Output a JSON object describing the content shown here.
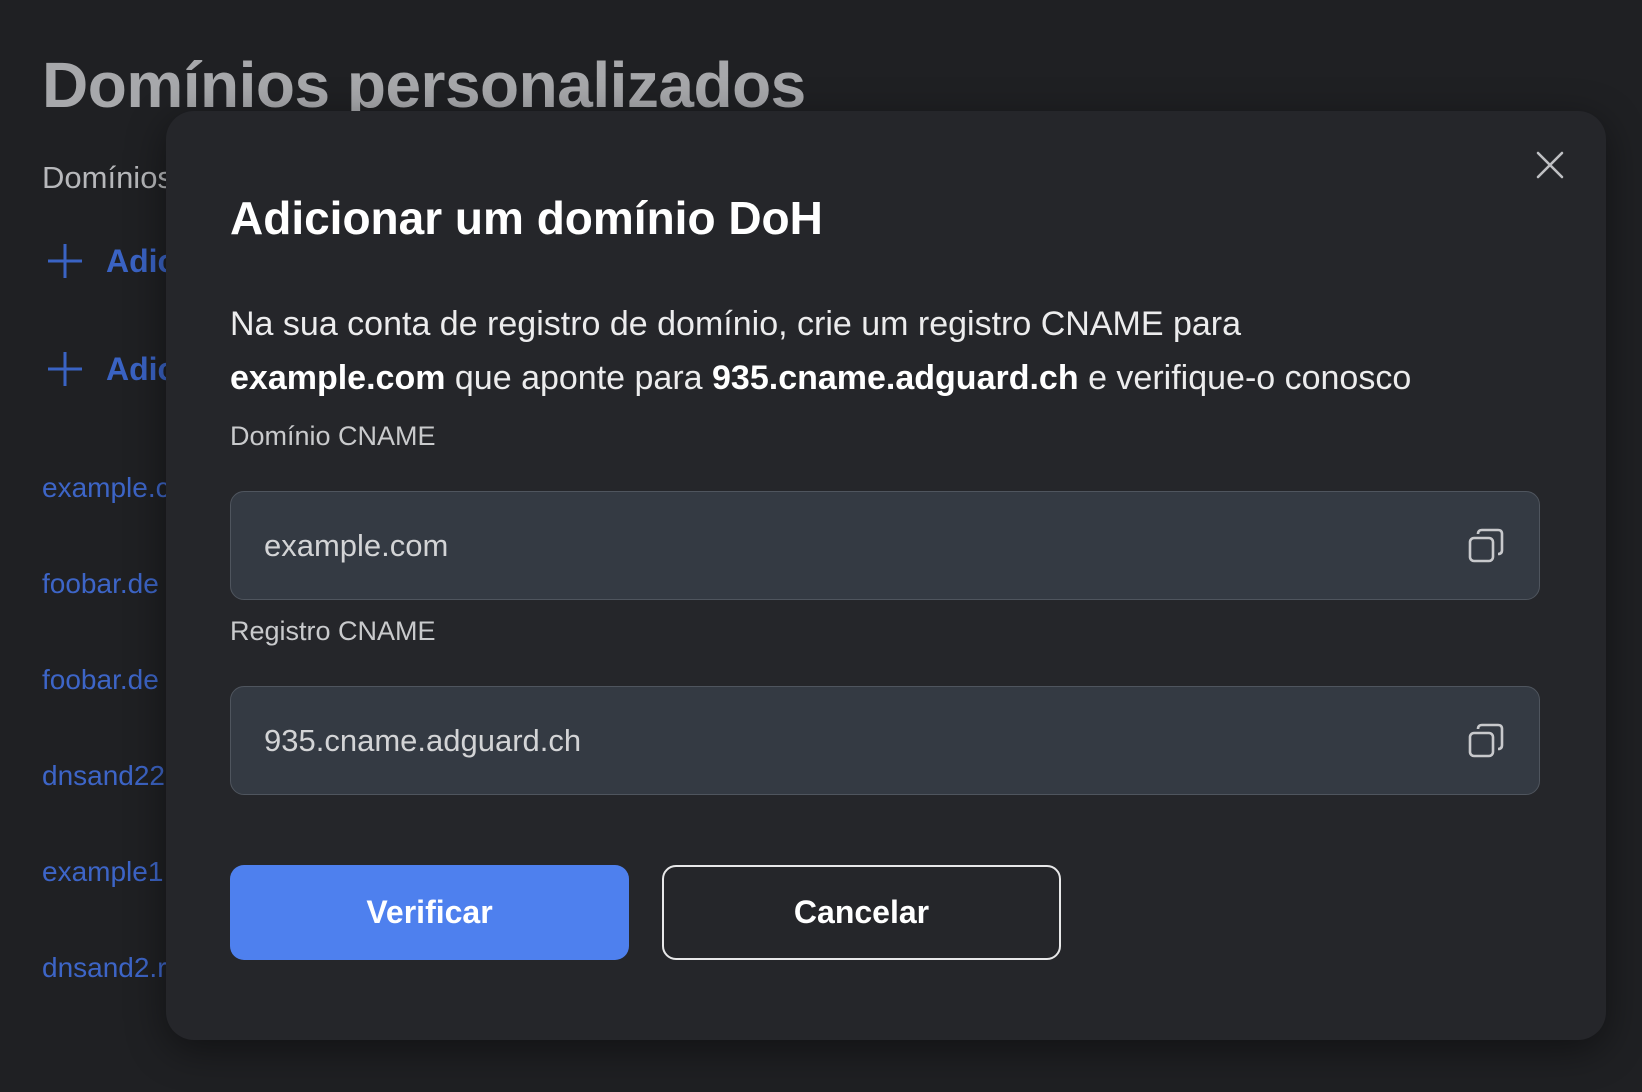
{
  "page": {
    "title": "Domínios personalizados",
    "subtitle": "Domínios",
    "add_items": [
      {
        "label": "Adic",
        "icon": "plus-icon"
      },
      {
        "label": "Adic",
        "icon": "plus-icon"
      }
    ],
    "domain_links": [
      "example.c",
      "foobar.de",
      "foobar.de",
      "dnsand22",
      "example1",
      "dnsand2.r"
    ]
  },
  "modal": {
    "title": "Adicionar um domínio DoH",
    "description": {
      "line1": "Na sua conta de registro de domínio, crie um registro CNAME para",
      "domain": "example.com",
      "middle": " que aponte para ",
      "target": "935.cname.adguard.ch",
      "end": " e verifique-o conosco"
    },
    "fields": [
      {
        "label": "Domínio CNAME",
        "value": "example.com",
        "icon": "copy-icon"
      },
      {
        "label": "Registro CNAME",
        "value": "935.cname.adguard.ch",
        "icon": "copy-icon"
      }
    ],
    "buttons": {
      "primary": "Verificar",
      "secondary": "Cancelar"
    },
    "close_icon": "close-icon"
  },
  "colors": {
    "background": "#1f2023",
    "modal": "#25262a",
    "accent": "#4e80ee",
    "link": "#3d65c7",
    "field": "#343a43"
  }
}
